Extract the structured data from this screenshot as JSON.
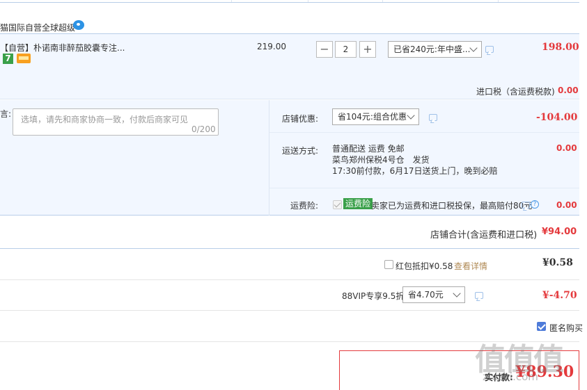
{
  "shop": {
    "title": "猫国际自营全球超级"
  },
  "item": {
    "name": "【自营】朴诺南非醉茄胶囊专注...",
    "badge_number": "7",
    "unit_price": "219.00",
    "quantity": "2",
    "minus_label": "−",
    "plus_label": "+",
    "promo_select": "已省240元:年中盛...",
    "subtotal": "198.00",
    "import_tax_label": "进口税（含运费税款)",
    "import_tax_value": "0.00"
  },
  "message": {
    "label": "言:",
    "placeholder": "选填，请先和商家协商一致，付款后商家可见",
    "count": "0/200"
  },
  "shop_discount": {
    "label": "店铺优惠:",
    "select": "省104元:组合优惠",
    "value": "-104.00"
  },
  "shipping": {
    "label": "运送方式:",
    "line1": "普通配送 运费 免邮",
    "line2": "菜鸟郑州保税4号仓　发货",
    "line3": "17:30前付款，6月17日送货上门，晚到必赔",
    "value": "0.00"
  },
  "insurance": {
    "label": "运费险:",
    "tag": "运费险",
    "text": "卖家已为运费和进口税投保，最高赔付80元",
    "value": "0.00"
  },
  "shop_total": {
    "label": "店铺合计(含运费和进口税)",
    "value": "¥94.00"
  },
  "red_packet": {
    "label": "红包抵扣¥0.58",
    "link": "查看详情",
    "value": "¥0.58"
  },
  "vip": {
    "label": "88VIP专享9.5折",
    "select": "省4.70元",
    "value": "¥-4.70"
  },
  "anonymous": {
    "label": "匿名购买"
  },
  "payment": {
    "label": "实付款:",
    "value": "¥89.30"
  },
  "watermark": {
    "text": "值值值",
    "url": "zhizhi.com"
  },
  "colors": {
    "accent_red": "#e4393c",
    "panel_blue": "#f2f7ff",
    "check_blue": "#4e7bd9",
    "tag_green": "#3aa04a"
  }
}
